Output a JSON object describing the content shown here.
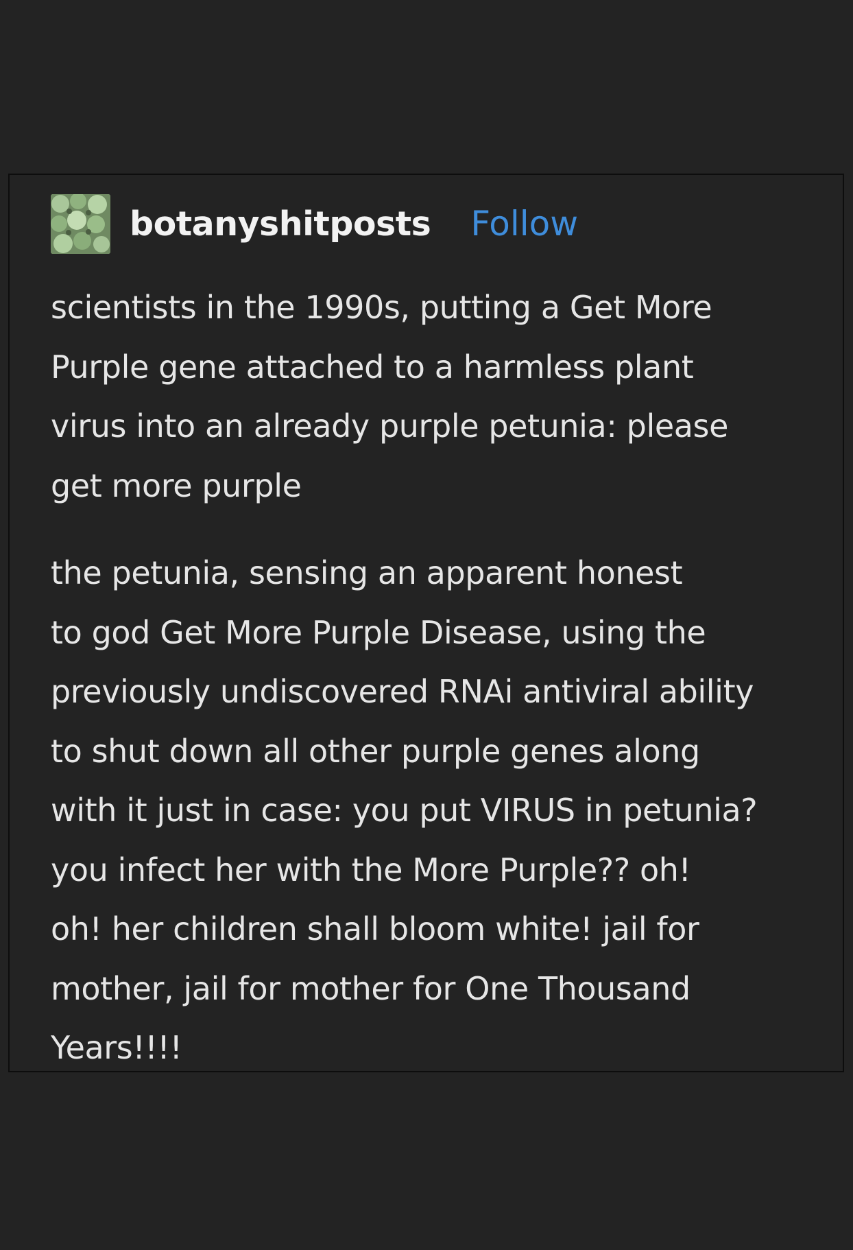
{
  "post": {
    "username": "botanyshitposts",
    "follow_label": "Follow",
    "avatar_icon": "succulent-avatar-icon",
    "paragraphs": [
      {
        "lines": [
          "scientists in the 1990s, putting a Get More",
          "Purple gene attached to a harmless plant",
          "virus into an already purple petunia: please",
          "get more purple"
        ]
      },
      {
        "lines": [
          "the petunia, sensing an apparent honest",
          "to god Get More Purple Disease, using the",
          "previously undiscovered RNAi antiviral ability",
          "to shut down all other purple genes along",
          "with it just in case: you put VIRUS in petunia?",
          "you infect her with the More Purple?? oh!",
          "oh! her children shall bloom white! jail for",
          "mother, jail for mother for One Thousand",
          "Years!!!!"
        ]
      }
    ]
  },
  "colors": {
    "background": "#232323",
    "text": "#e6e6e6",
    "follow": "#3f8ddb"
  }
}
